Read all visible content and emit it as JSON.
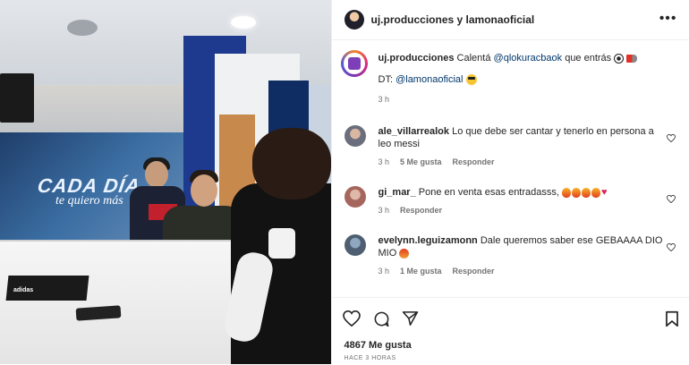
{
  "photo": {
    "mural_line1": "CADA DÍA",
    "mural_line2": "te quiero más",
    "box_label": "adidas"
  },
  "header": {
    "title": "uj.producciones y lamonaoficial",
    "more_icon": "more-horizontal-icon"
  },
  "caption": {
    "username": "uj.producciones",
    "text_before": "Calentá ",
    "mention1": "@qlokuracbaok",
    "text_after": " que entrás ",
    "line2_prefix": "DT: ",
    "mention2": "@lamonaoficial",
    "time": "3 h"
  },
  "comments": [
    {
      "username": "ale_villarrealok",
      "text": "Lo que debe ser cantar y tenerlo en persona a leo messi",
      "time": "3 h",
      "likes": "5 Me gusta",
      "reply": "Responder"
    },
    {
      "username": "gi_mar_",
      "text": "Pone en venta esas entradasss,",
      "time": "3 h",
      "reply": "Responder"
    },
    {
      "username": "evelynn.leguizamonn",
      "text": "Dale queremos saber ese GEBAAAA DIO MIO",
      "time": "3 h",
      "likes": "1 Me gusta",
      "reply": "Responder"
    }
  ],
  "footer": {
    "likes": "4867 Me gusta",
    "time_ago": "HACE 3 HORAS"
  },
  "colors": {
    "mention": "#00376b",
    "secondary_text": "#737373",
    "primary_text": "#262626"
  }
}
